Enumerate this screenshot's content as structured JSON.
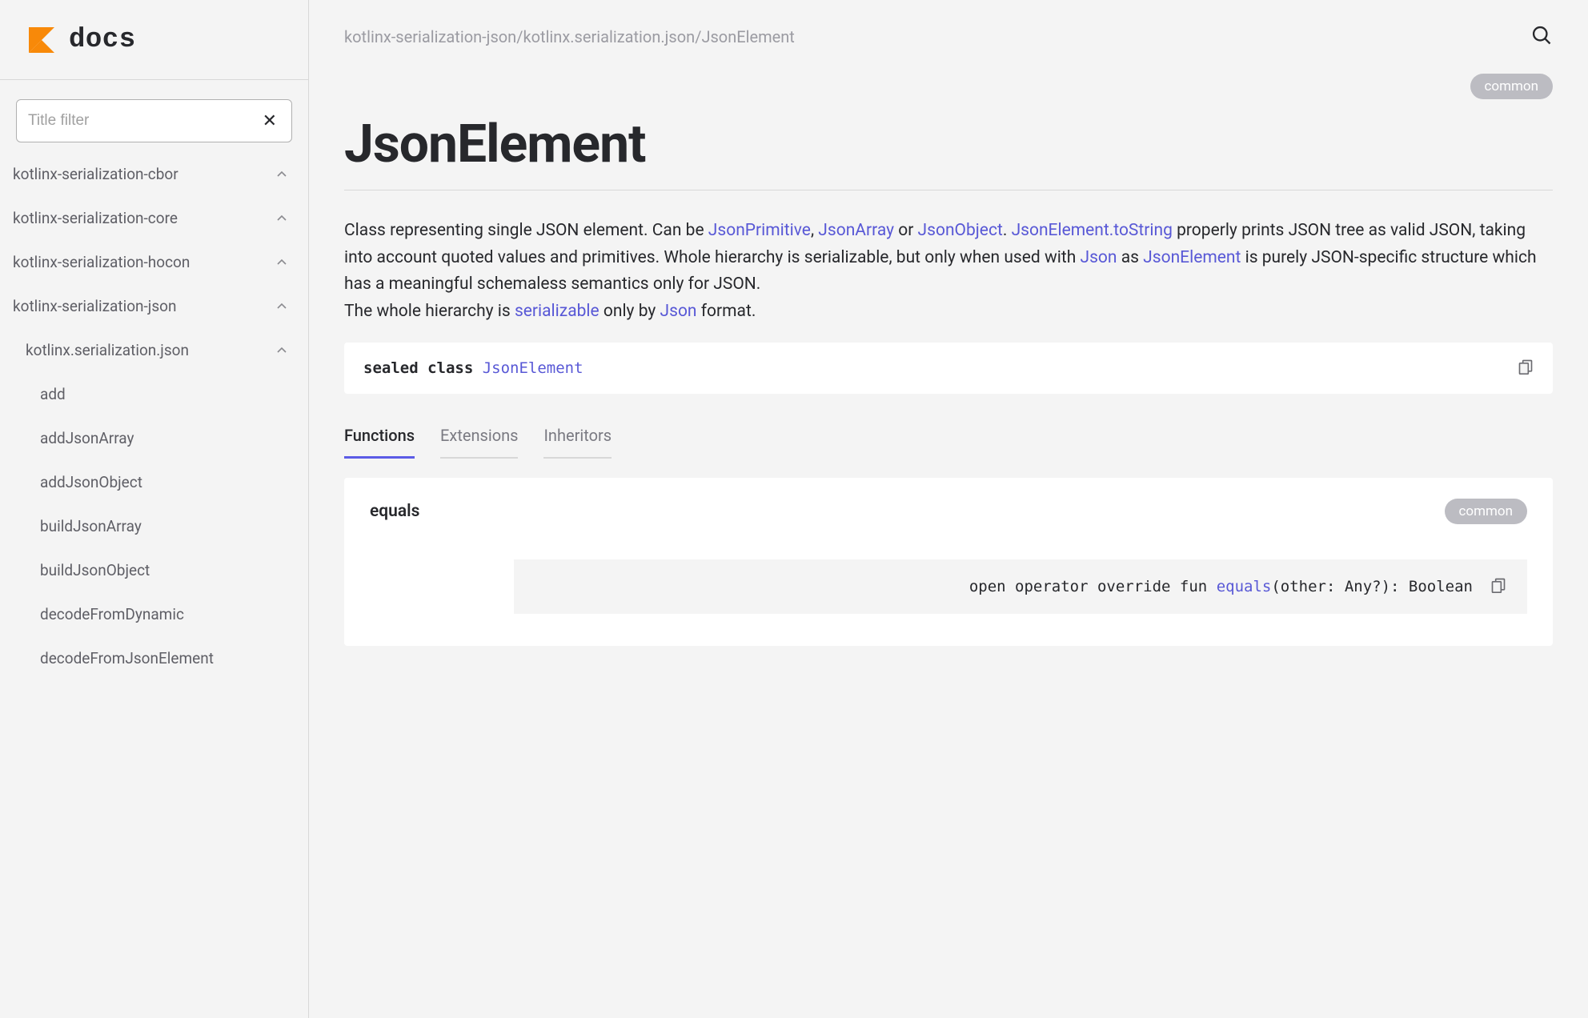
{
  "logo_text": "docs",
  "filter_placeholder": "Title filter",
  "nav": [
    {
      "label": "kotlinx-serialization-cbor",
      "level": 0,
      "chev": true
    },
    {
      "label": "kotlinx-serialization-core",
      "level": 0,
      "chev": true
    },
    {
      "label": "kotlinx-serialization-hocon",
      "level": 0,
      "chev": true
    },
    {
      "label": "kotlinx-serialization-json",
      "level": 0,
      "chev": true
    },
    {
      "label": "kotlinx.serialization.json",
      "level": 1,
      "chev": true
    },
    {
      "label": "add",
      "level": 2,
      "chev": false
    },
    {
      "label": "addJsonArray",
      "level": 2,
      "chev": false
    },
    {
      "label": "addJsonObject",
      "level": 2,
      "chev": false
    },
    {
      "label": "buildJsonArray",
      "level": 2,
      "chev": false
    },
    {
      "label": "buildJsonObject",
      "level": 2,
      "chev": false
    },
    {
      "label": "decodeFromDynamic",
      "level": 2,
      "chev": false
    },
    {
      "label": "decodeFromJsonElement",
      "level": 2,
      "chev": false
    }
  ],
  "breadcrumb": "kotlinx-serialization-json/kotlinx.serialization.json/JsonElement",
  "badge": "common",
  "page_title": "JsonElement",
  "desc": {
    "t1": "Class representing single JSON element. Can be ",
    "l1": "JsonPrimitive",
    "t2": ", ",
    "l2": "JsonArray",
    "t3": " or ",
    "l3": "JsonObject",
    "t4": ". ",
    "l4": "JsonElement.toString",
    "t5": " properly prints JSON tree as valid JSON, taking into account quoted values and primitives. Whole hierarchy is serializable, but only when used with ",
    "l5": "Json",
    "t6": " as ",
    "l6": "JsonElement",
    "t7": " is purely JSON-specific structure which has a meaningful schemaless semantics only for JSON.",
    "t8": "The whole hierarchy is ",
    "l7": "serializable",
    "t9": " only by ",
    "l8": "Json",
    "t10": " format."
  },
  "code": {
    "kw": "sealed class ",
    "cls": "JsonElement"
  },
  "tabs": {
    "functions": "Functions",
    "extensions": "Extensions",
    "inheritors": "Inheritors"
  },
  "func": {
    "name": "equals",
    "badge": "common",
    "sig_pre": "open operator override fun ",
    "sig_fn": "equals",
    "sig_post": "(other: Any?): Boolean"
  }
}
